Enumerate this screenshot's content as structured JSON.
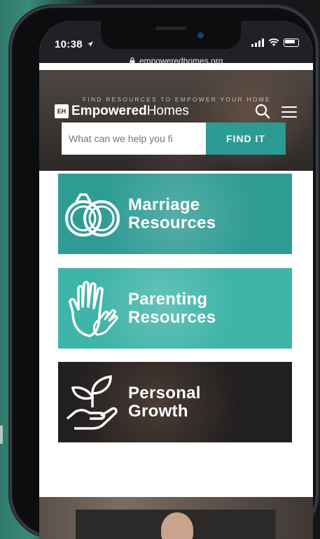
{
  "status": {
    "time": "10:38",
    "url": "empoweredhomes.org"
  },
  "header": {
    "tagline": "FIND RESOURCES TO EMPOWER YOUR HOME",
    "logo_bold": "Empowered",
    "logo_light": "Homes",
    "logo_badge": "EH"
  },
  "search": {
    "placeholder": "What can we help you fi",
    "button_label": "FIND IT"
  },
  "tiles": [
    {
      "line1": "Marriage",
      "line2": "Resources",
      "icon": "rings-icon"
    },
    {
      "line1": "Parenting",
      "line2": "Resources",
      "icon": "hands-icon"
    },
    {
      "line1": "Personal",
      "line2": "Growth",
      "icon": "plant-hand-icon"
    }
  ],
  "colors": {
    "marriage_tile": "#2f9c94",
    "parenting_tile": "#3fb4a8",
    "growth_tile": "#221f1f",
    "find_button": "#2b9b93"
  }
}
